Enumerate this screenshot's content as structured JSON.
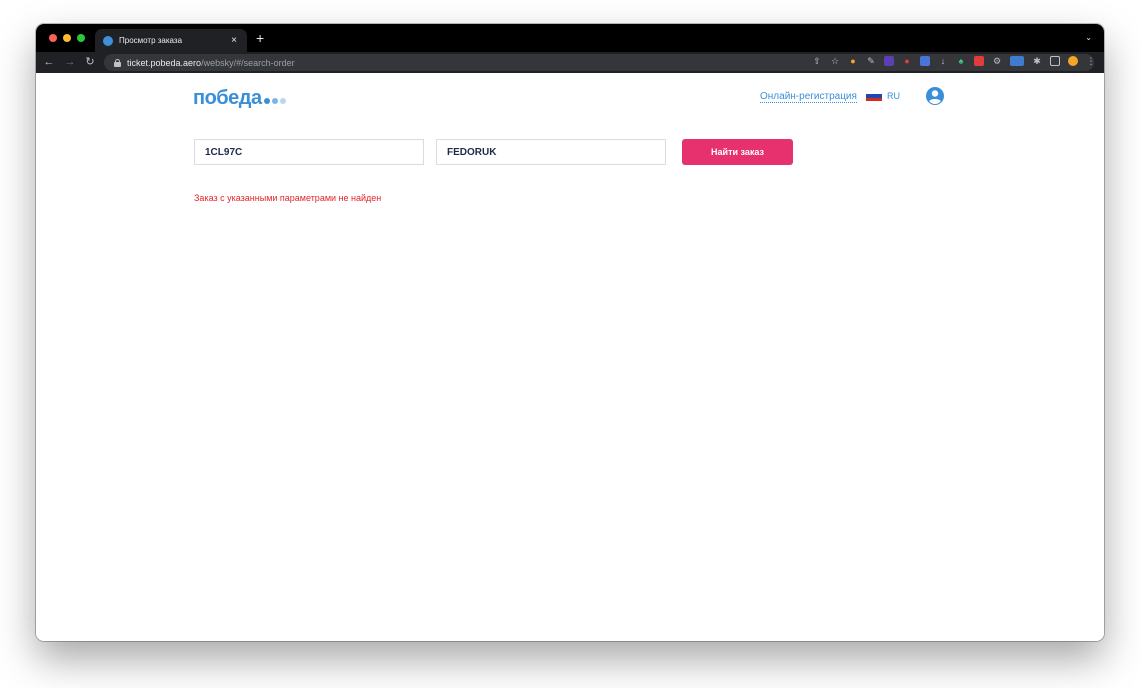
{
  "browser": {
    "tab_title": "Просмотр заказа",
    "tab_close": "×",
    "new_tab": "+",
    "tab_menu": "⌄",
    "url_host": "ticket.pobeda.aero",
    "url_path": "/websky/#/search-order"
  },
  "header": {
    "logo": "победа",
    "logo_dot_colors": [
      "#3a8fd9",
      "#7db5e8",
      "#b8d6f2"
    ],
    "checkin_link": "Онлайн-регистрация",
    "lang": "RU",
    "flag_colors": [
      "#ffffff",
      "#1f46b8",
      "#d52b1e"
    ]
  },
  "form": {
    "booking_code": "1CL97C",
    "last_name": "FEDORUK",
    "submit_label": "Найти заказ"
  },
  "error_message": "Заказ с указанными параметрами не найден",
  "colors": {
    "brand_blue": "#3a8fd9",
    "button_pink": "#e6316e",
    "error_red": "#e5252a"
  }
}
